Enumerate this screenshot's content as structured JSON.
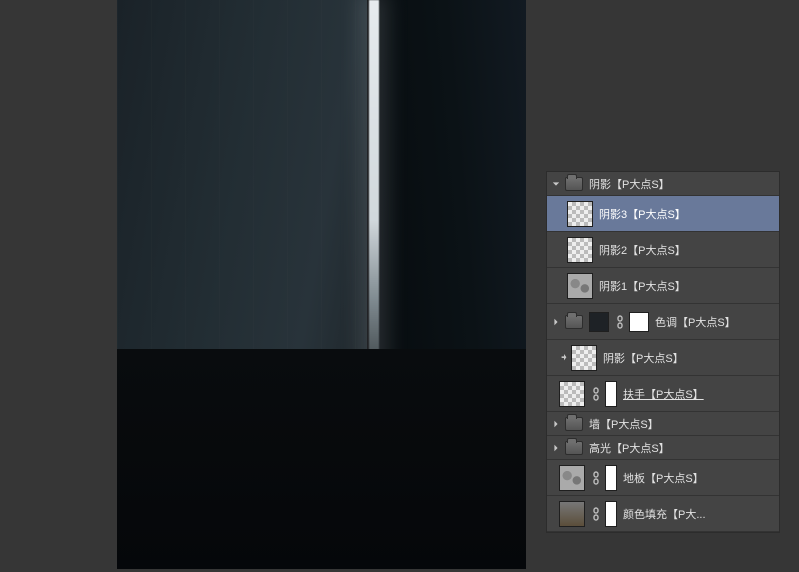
{
  "canvas": {
    "description": "Dark concrete stairwell with a bright vertical light slit"
  },
  "layers": {
    "group": {
      "name": "阴影【P大点S】",
      "children": [
        {
          "name": "阴影3【P大点S】",
          "selected": true
        },
        {
          "name": "阴影2【P大点S】"
        },
        {
          "name": "阴影1【P大点S】"
        }
      ]
    },
    "tone_group": "色调【P大点S】",
    "clip_layer": "阴影【P大点S】",
    "handrail": "扶手【P大点S】",
    "wall_group": "墙【P大点S】",
    "highlight_group": "高光【P大点S】",
    "floor": "地板【P大点S】",
    "fill": "颜色填充【P大..."
  }
}
